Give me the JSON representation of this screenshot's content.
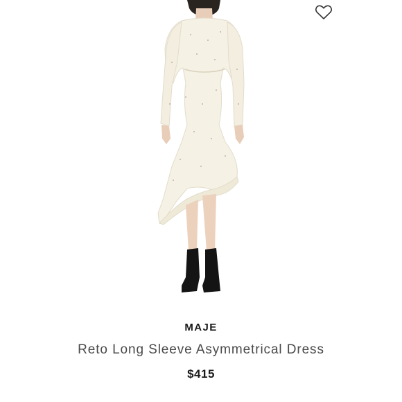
{
  "product": {
    "brand": "MAJE",
    "title": "Reto Long Sleeve Asymmetrical Dress",
    "price": "$415"
  },
  "icons": {
    "favorite": "heart-outline-icon"
  },
  "colors": {
    "dress": "#f5f1e4",
    "text_dark": "#1a1a1a",
    "text_muted": "#4a4a4a",
    "boots": "#141414"
  }
}
